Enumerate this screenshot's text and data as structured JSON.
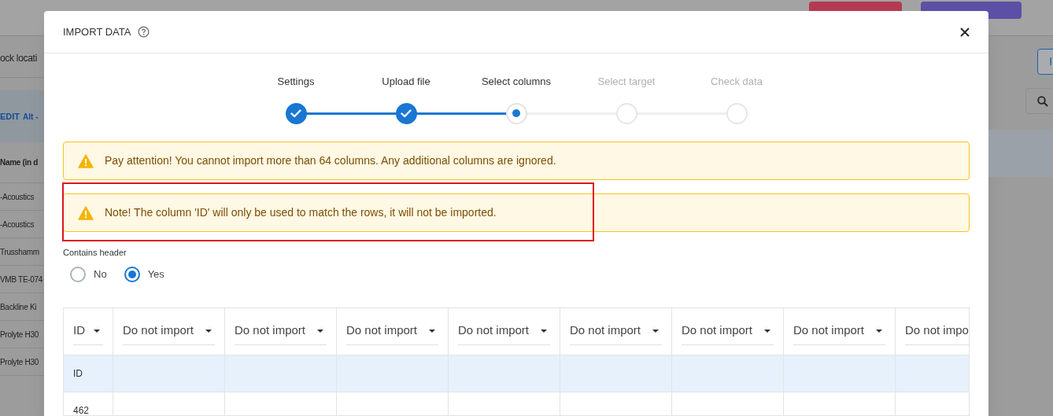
{
  "background": {
    "left_items": [
      {
        "kind": "heading",
        "text": "ock locati"
      },
      {
        "kind": "toolbar",
        "text": "EDIT",
        "shortcut": "Alt -"
      },
      {
        "kind": "column",
        "text": "Name (in d"
      },
      {
        "kind": "row",
        "text": "-Acoustics"
      },
      {
        "kind": "row",
        "text": "-Acoustics"
      },
      {
        "kind": "row",
        "text": "Trusshamm"
      },
      {
        "kind": "row",
        "text": "VMB TE-074"
      },
      {
        "kind": "row",
        "text": "Backline Ki"
      },
      {
        "kind": "row",
        "text": "Prolyte H30"
      },
      {
        "kind": "row",
        "text": "Prolyte H30"
      }
    ],
    "right_button": "I"
  },
  "dialog": {
    "title": "IMPORT DATA",
    "steps": [
      {
        "label": "Settings",
        "done": true,
        "selected": false
      },
      {
        "label": "Upload file",
        "done": true,
        "selected": false
      },
      {
        "label": "Select columns",
        "done": false,
        "selected": true
      },
      {
        "label": "Select target",
        "done": false,
        "selected": false
      },
      {
        "label": "Check data",
        "done": false,
        "selected": false
      }
    ],
    "alerts": [
      {
        "text": "Pay attention! You cannot import more than 64 columns. Any additional columns are ignored.",
        "highlighted": false
      },
      {
        "text": "Note! The column 'ID' will only be used to match the rows, it will not be imported.",
        "highlighted": true
      }
    ],
    "contains_header": {
      "label": "Contains header",
      "options": [
        {
          "label": "No",
          "selected": false
        },
        {
          "label": "Yes",
          "selected": true
        }
      ]
    },
    "table": {
      "columns": [
        "ID",
        "Do not import",
        "Do not import",
        "Do not import",
        "Do not import",
        "Do not import",
        "Do not import",
        "Do not import",
        "Do not impo"
      ],
      "rows": [
        {
          "header": true,
          "cells": [
            "ID"
          ]
        },
        {
          "header": false,
          "cells": [
            "462"
          ]
        }
      ]
    }
  }
}
